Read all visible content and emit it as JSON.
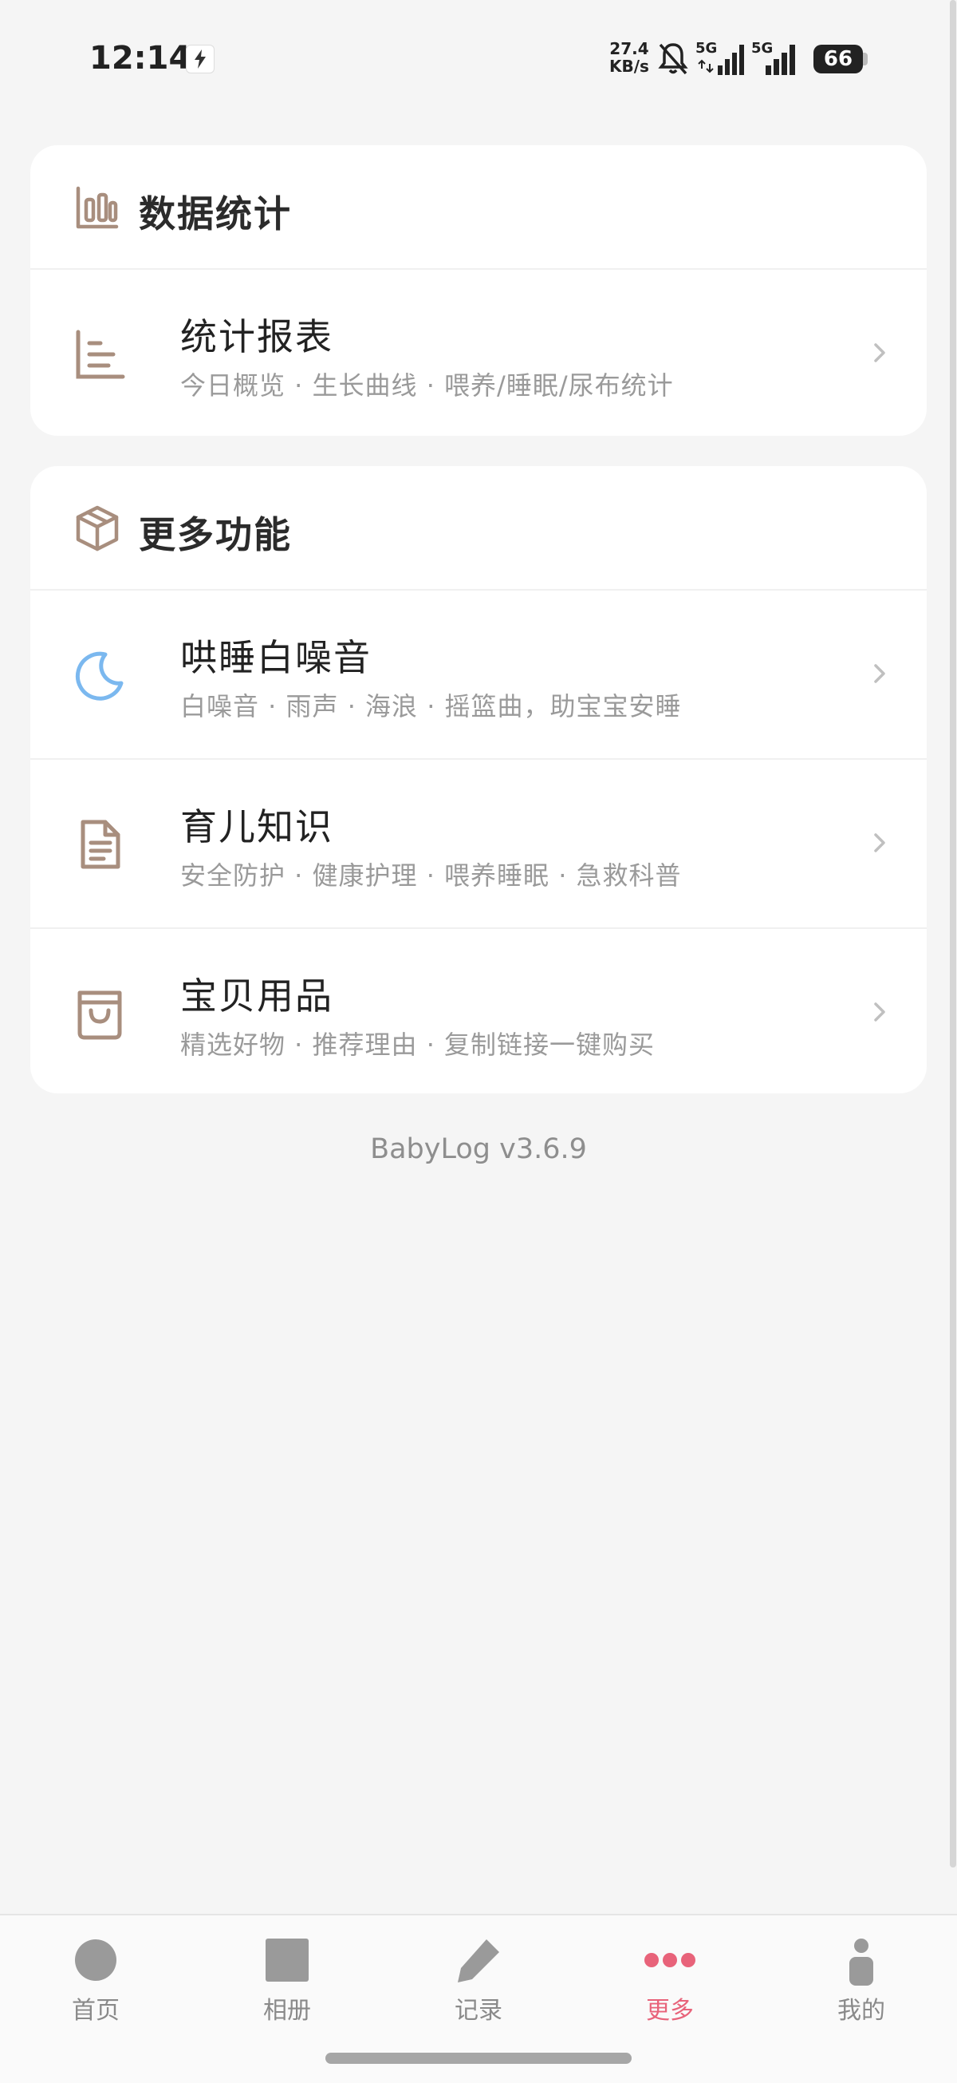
{
  "status_bar": {
    "time": "12:14",
    "net_speed_value": "27.4",
    "net_speed_unit": "KB/s",
    "signal1_label": "5G",
    "signal2_label": "5G",
    "battery": "66"
  },
  "stats_card": {
    "title": "数据统计",
    "icon": "bar-chart-icon",
    "items": [
      {
        "title": "统计报表",
        "subtitle": "今日概览 · 生长曲线 · 喂养/睡眠/尿布统计",
        "icon": "report-chart-icon"
      }
    ]
  },
  "more_card": {
    "title": "更多功能",
    "icon": "box-icon",
    "items": [
      {
        "title": "哄睡白噪音",
        "subtitle": "白噪音 · 雨声 · 海浪 · 摇篮曲，助宝宝安睡",
        "icon": "moon-icon"
      },
      {
        "title": "育儿知识",
        "subtitle": "安全防护 · 健康护理 · 喂养睡眠 · 急救科普",
        "icon": "document-icon"
      },
      {
        "title": "宝贝用品",
        "subtitle": "精选好物 · 推荐理由 · 复制链接一键购买",
        "icon": "shopping-bag-icon"
      }
    ]
  },
  "version": "BabyLog v3.6.9",
  "tabs": [
    {
      "label": "首页",
      "icon": "home-circle-icon"
    },
    {
      "label": "相册",
      "icon": "album-square-icon"
    },
    {
      "label": "记录",
      "icon": "pencil-icon"
    },
    {
      "label": "更多",
      "icon": "more-dots-icon",
      "active": true
    },
    {
      "label": "我的",
      "icon": "person-icon"
    }
  ],
  "colors": {
    "accent": "#e8637a",
    "icon_brown": "#a88e7e",
    "icon_blue": "#7bb8ef",
    "background": "#f5f5f5"
  }
}
